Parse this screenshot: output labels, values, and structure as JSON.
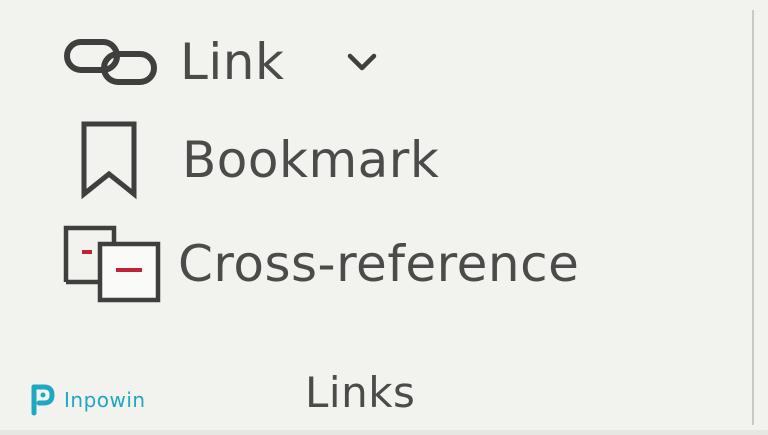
{
  "ribbon": {
    "group_label": "Links",
    "commands": {
      "link": {
        "label": "Link",
        "icon": "link-icon",
        "has_dropdown": true
      },
      "bookmark": {
        "label": "Bookmark",
        "icon": "bookmark-icon"
      },
      "cross_reference": {
        "label": "Cross-reference",
        "icon": "cross-reference-icon"
      }
    }
  },
  "watermark": {
    "text": "Inpowin"
  },
  "colors": {
    "background": "#f2f2ef",
    "text": "#4b4b49",
    "icon_stroke": "#3f3f3d",
    "accent_red": "#c0223a",
    "watermark": "#20a7c4"
  }
}
